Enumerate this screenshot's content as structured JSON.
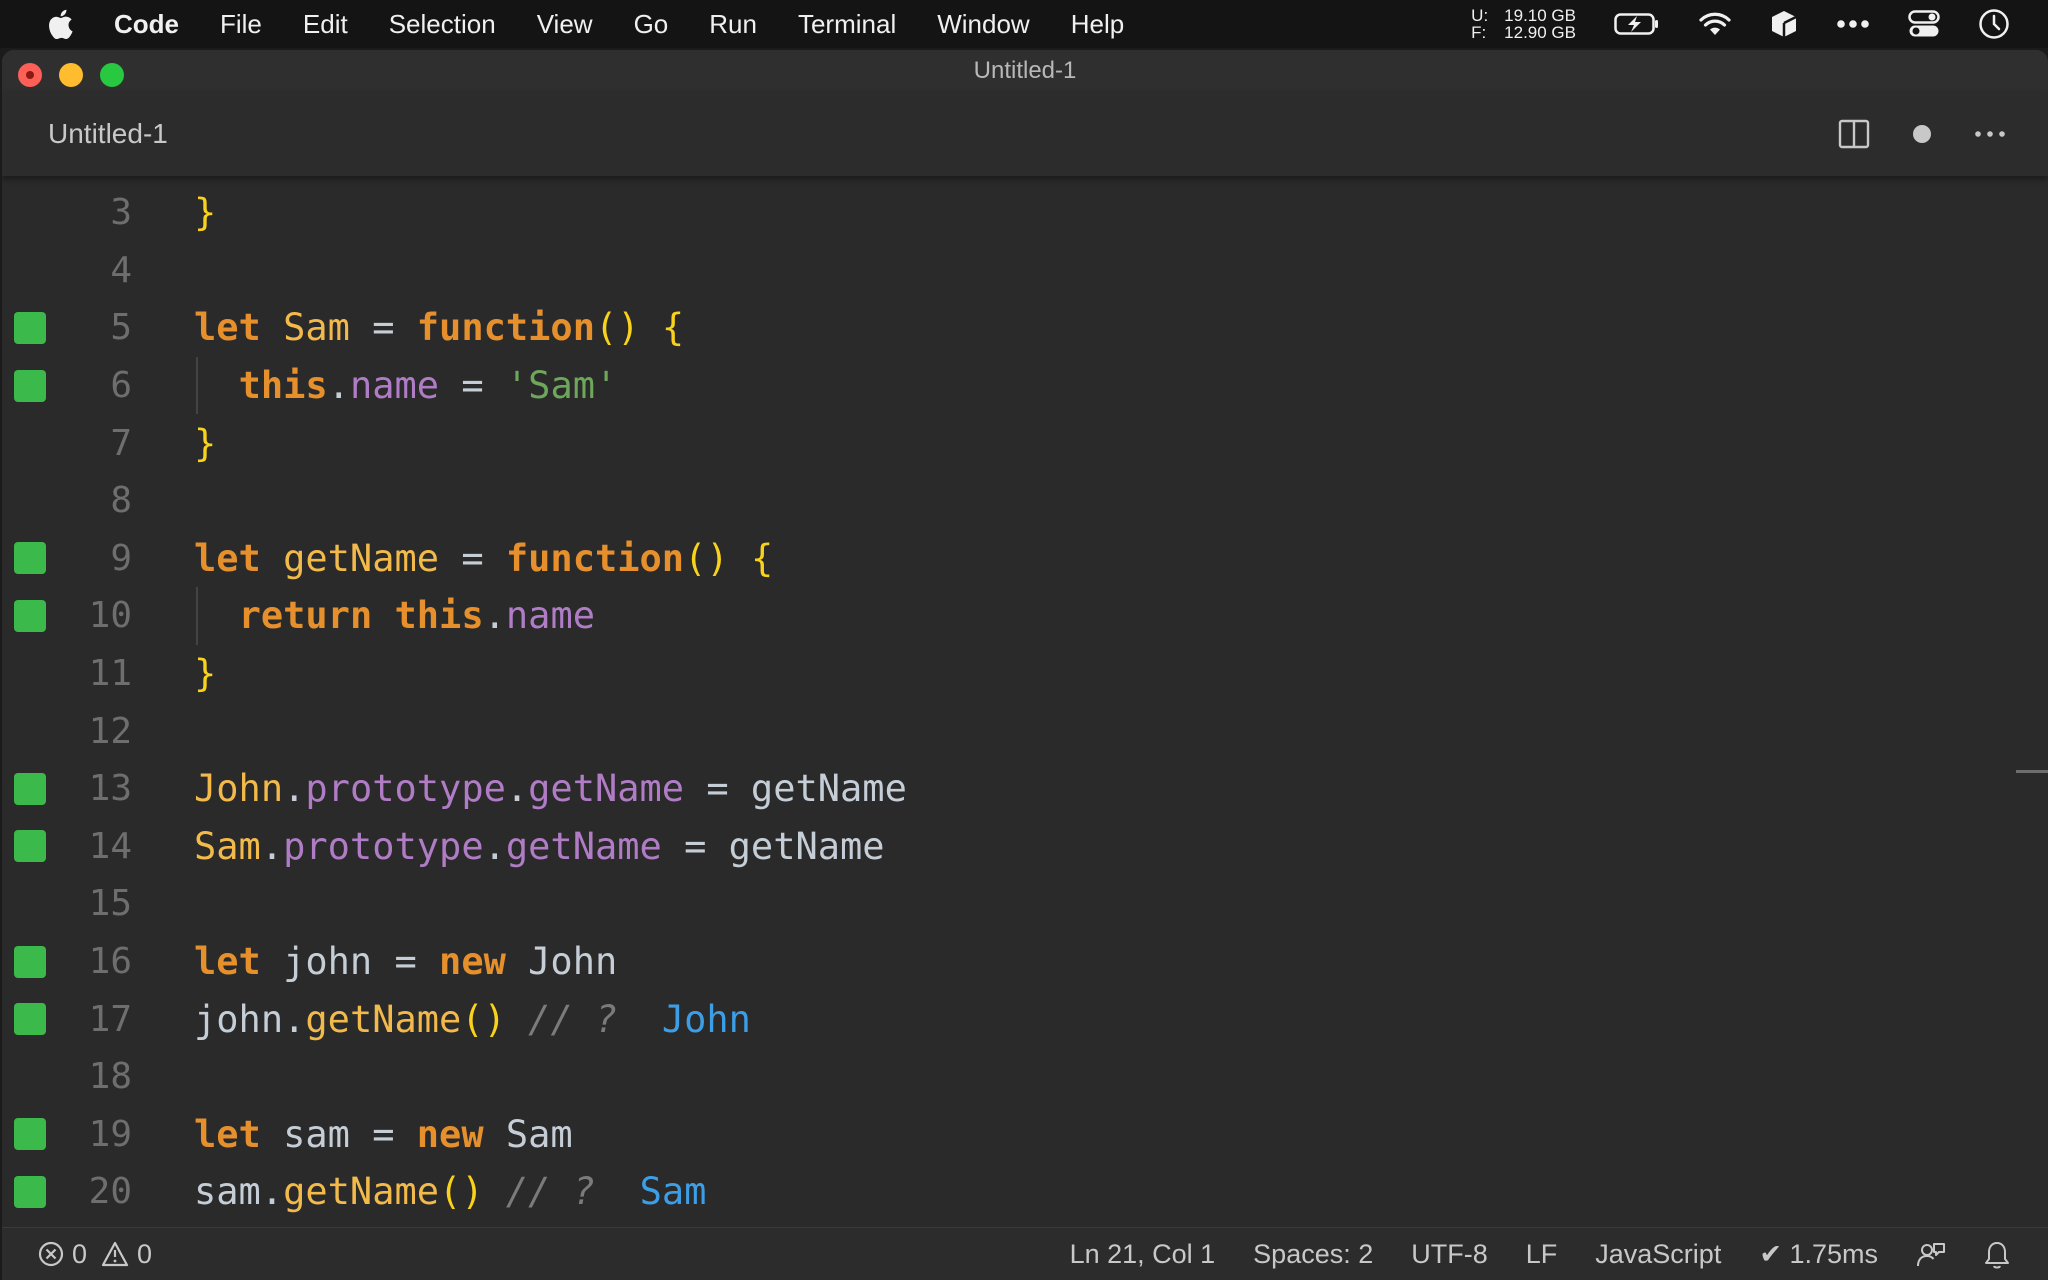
{
  "menubar": {
    "app_name": "Code",
    "items": [
      "File",
      "Edit",
      "Selection",
      "View",
      "Go",
      "Run",
      "Terminal",
      "Window",
      "Help"
    ],
    "memory": {
      "used_label": "U:",
      "used_value": "19.10 GB",
      "free_label": "F:",
      "free_value": "12.90 GB"
    },
    "tray_icons": [
      "battery-charging-icon",
      "wifi-icon",
      "package-icon",
      "more-icon",
      "control-center-icon",
      "clock-icon"
    ]
  },
  "window": {
    "title": "Untitled-1"
  },
  "tab": {
    "title": "Untitled-1",
    "actions": [
      "split-editor-icon",
      "unsaved-dot-icon",
      "more-actions-icon"
    ]
  },
  "editor": {
    "lines": [
      {
        "num": "3",
        "marker": false,
        "guide": false,
        "tokens": [
          {
            "t": "}",
            "c": "brace"
          }
        ]
      },
      {
        "num": "4",
        "marker": false,
        "guide": false,
        "tokens": []
      },
      {
        "num": "5",
        "marker": true,
        "guide": false,
        "tokens": [
          {
            "t": "let",
            "c": "kw"
          },
          {
            "t": " ",
            "c": "plain"
          },
          {
            "t": "Sam",
            "c": "ident"
          },
          {
            "t": " = ",
            "c": "plain"
          },
          {
            "t": "function",
            "c": "kw"
          },
          {
            "t": "()",
            "c": "paren"
          },
          {
            "t": " ",
            "c": "plain"
          },
          {
            "t": "{",
            "c": "brace"
          }
        ]
      },
      {
        "num": "6",
        "marker": true,
        "guide": true,
        "tokens": [
          {
            "t": "  ",
            "c": "plain"
          },
          {
            "t": "this",
            "c": "kw"
          },
          {
            "t": ".",
            "c": "plain"
          },
          {
            "t": "name",
            "c": "prop"
          },
          {
            "t": " = ",
            "c": "plain"
          },
          {
            "t": "'Sam'",
            "c": "str"
          }
        ]
      },
      {
        "num": "7",
        "marker": false,
        "guide": false,
        "tokens": [
          {
            "t": "}",
            "c": "brace"
          }
        ]
      },
      {
        "num": "8",
        "marker": false,
        "guide": false,
        "tokens": []
      },
      {
        "num": "9",
        "marker": true,
        "guide": false,
        "tokens": [
          {
            "t": "let",
            "c": "kw"
          },
          {
            "t": " ",
            "c": "plain"
          },
          {
            "t": "getName",
            "c": "ident"
          },
          {
            "t": " = ",
            "c": "plain"
          },
          {
            "t": "function",
            "c": "kw"
          },
          {
            "t": "()",
            "c": "paren"
          },
          {
            "t": " ",
            "c": "plain"
          },
          {
            "t": "{",
            "c": "brace"
          }
        ]
      },
      {
        "num": "10",
        "marker": true,
        "guide": true,
        "tokens": [
          {
            "t": "  ",
            "c": "plain"
          },
          {
            "t": "return",
            "c": "kw"
          },
          {
            "t": " ",
            "c": "plain"
          },
          {
            "t": "this",
            "c": "kw"
          },
          {
            "t": ".",
            "c": "plain"
          },
          {
            "t": "name",
            "c": "prop"
          }
        ]
      },
      {
        "num": "11",
        "marker": false,
        "guide": false,
        "tokens": [
          {
            "t": "}",
            "c": "brace"
          }
        ]
      },
      {
        "num": "12",
        "marker": false,
        "guide": false,
        "tokens": []
      },
      {
        "num": "13",
        "marker": true,
        "guide": false,
        "tokens": [
          {
            "t": "John",
            "c": "ident"
          },
          {
            "t": ".",
            "c": "plain"
          },
          {
            "t": "prototype",
            "c": "prop"
          },
          {
            "t": ".",
            "c": "plain"
          },
          {
            "t": "getName",
            "c": "prop"
          },
          {
            "t": " = ",
            "c": "plain"
          },
          {
            "t": "getName",
            "c": "plain"
          }
        ]
      },
      {
        "num": "14",
        "marker": true,
        "guide": false,
        "tokens": [
          {
            "t": "Sam",
            "c": "ident"
          },
          {
            "t": ".",
            "c": "plain"
          },
          {
            "t": "prototype",
            "c": "prop"
          },
          {
            "t": ".",
            "c": "plain"
          },
          {
            "t": "getName",
            "c": "prop"
          },
          {
            "t": " = ",
            "c": "plain"
          },
          {
            "t": "getName",
            "c": "plain"
          }
        ]
      },
      {
        "num": "15",
        "marker": false,
        "guide": false,
        "tokens": []
      },
      {
        "num": "16",
        "marker": true,
        "guide": false,
        "tokens": [
          {
            "t": "let",
            "c": "kw"
          },
          {
            "t": " ",
            "c": "plain"
          },
          {
            "t": "john",
            "c": "plain"
          },
          {
            "t": " = ",
            "c": "plain"
          },
          {
            "t": "new",
            "c": "kw"
          },
          {
            "t": " ",
            "c": "plain"
          },
          {
            "t": "John",
            "c": "plain"
          }
        ]
      },
      {
        "num": "17",
        "marker": true,
        "guide": false,
        "tokens": [
          {
            "t": "john",
            "c": "plain"
          },
          {
            "t": ".",
            "c": "plain"
          },
          {
            "t": "getName",
            "c": "fn"
          },
          {
            "t": "()",
            "c": "paren"
          },
          {
            "t": " ",
            "c": "plain"
          },
          {
            "t": "// ?",
            "c": "cmt"
          },
          {
            "t": "  ",
            "c": "plain"
          },
          {
            "t": "John",
            "c": "result"
          }
        ]
      },
      {
        "num": "18",
        "marker": false,
        "guide": false,
        "tokens": []
      },
      {
        "num": "19",
        "marker": true,
        "guide": false,
        "tokens": [
          {
            "t": "let",
            "c": "kw"
          },
          {
            "t": " ",
            "c": "plain"
          },
          {
            "t": "sam",
            "c": "plain"
          },
          {
            "t": " = ",
            "c": "plain"
          },
          {
            "t": "new",
            "c": "kw"
          },
          {
            "t": " ",
            "c": "plain"
          },
          {
            "t": "Sam",
            "c": "plain"
          }
        ]
      },
      {
        "num": "20",
        "marker": true,
        "guide": false,
        "tokens": [
          {
            "t": "sam",
            "c": "plain"
          },
          {
            "t": ".",
            "c": "plain"
          },
          {
            "t": "getName",
            "c": "fn"
          },
          {
            "t": "()",
            "c": "paren"
          },
          {
            "t": " ",
            "c": "plain"
          },
          {
            "t": "// ?",
            "c": "cmt"
          },
          {
            "t": "  ",
            "c": "plain"
          },
          {
            "t": "Sam",
            "c": "result"
          }
        ]
      }
    ]
  },
  "statusbar": {
    "errors": "0",
    "warnings": "0",
    "position": "Ln 21, Col 1",
    "spaces": "Spaces: 2",
    "encoding": "UTF-8",
    "eol": "LF",
    "language": "JavaScript",
    "timing": "✔ 1.75ms"
  },
  "colors": {
    "gutter_marker": "#3cb94b",
    "keyword": "#e58f2d",
    "identifier": "#f2ba4a",
    "property": "#b07cc6",
    "string": "#6ea65b",
    "result": "#3d9ee6"
  }
}
